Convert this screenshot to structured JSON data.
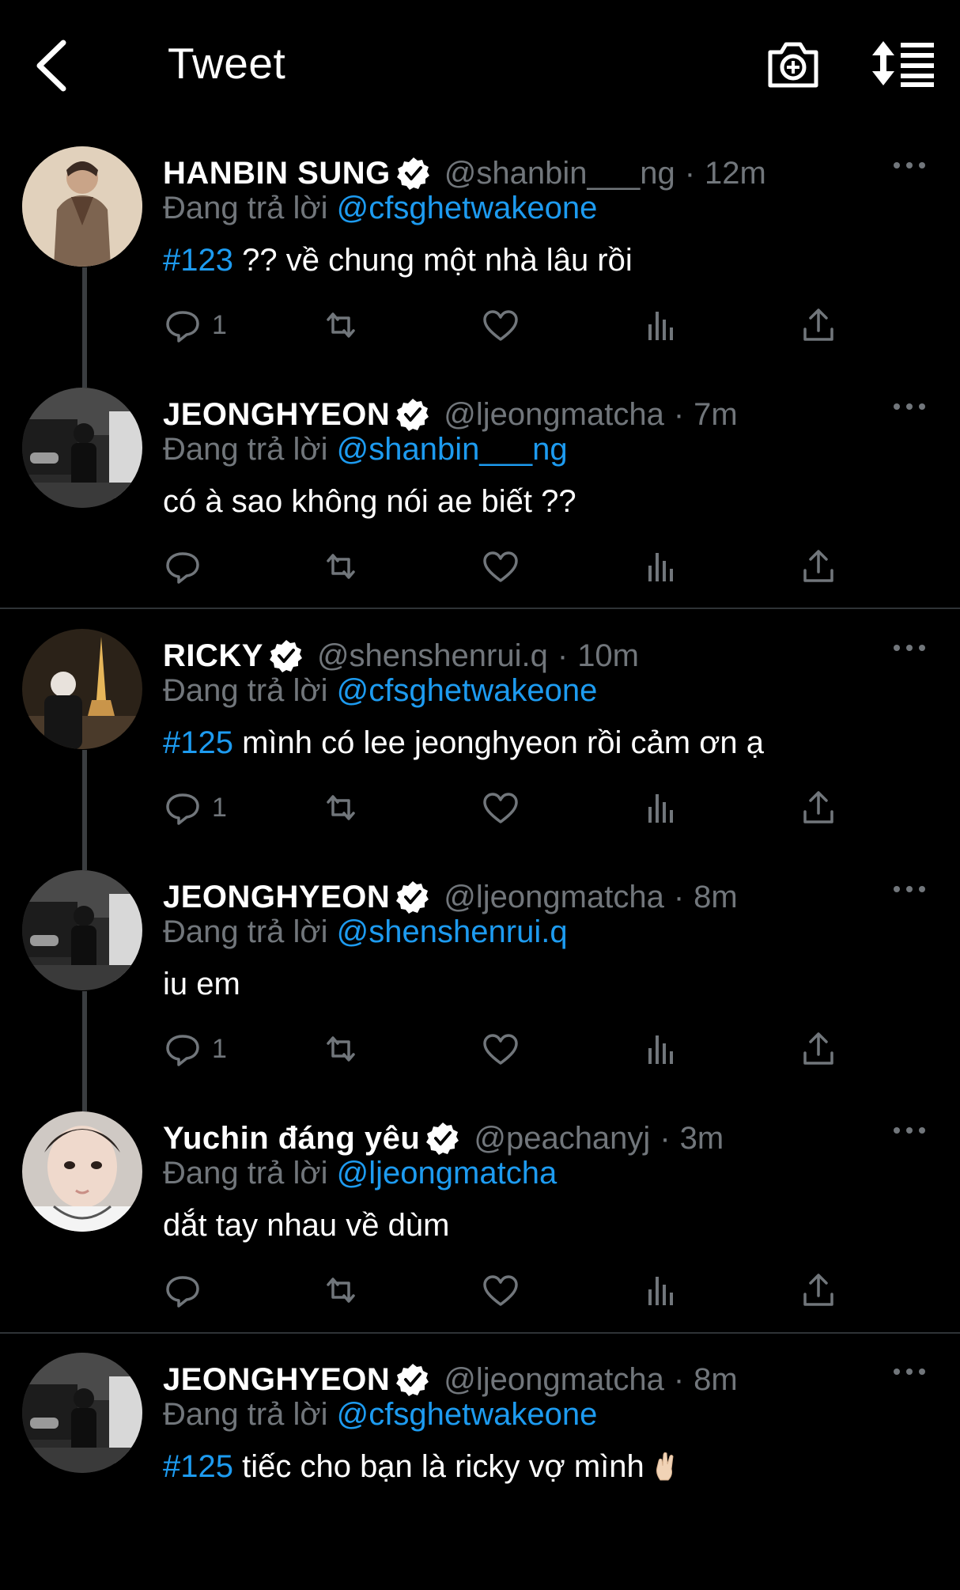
{
  "header": {
    "title": "Tweet"
  },
  "tweets": [
    {
      "name": "HANBIN SUNG",
      "handle": "@shanbin___ng",
      "time": "12m",
      "reply_prefix": "Đang trả lời",
      "reply_to": "@cfsghetwakeone",
      "tag": "#123",
      "text": " ?? về chung một nhà lâu rồi",
      "replies": "1"
    },
    {
      "name": "JEONGHYEON",
      "handle": "@ljeongmatcha",
      "time": "7m",
      "reply_prefix": "Đang trả lời",
      "reply_to": "@shanbin___ng",
      "tag": "",
      "text": "có à sao không nói ae biết ??",
      "replies": ""
    },
    {
      "name": "RICKY",
      "handle": "@shenshenrui.q",
      "time": "10m",
      "reply_prefix": "Đang trả lời",
      "reply_to": "@cfsghetwakeone",
      "tag": "#125",
      "text": " mình có lee jeonghyeon rồi cảm ơn ạ",
      "replies": "1"
    },
    {
      "name": "JEONGHYEON",
      "handle": "@ljeongmatcha",
      "time": "8m",
      "reply_prefix": "Đang trả lời",
      "reply_to": "@shenshenrui.q",
      "tag": "",
      "text": "iu em",
      "replies": "1"
    },
    {
      "name": "Yuchin đáng yêu",
      "handle": "@peachanyj",
      "time": "3m",
      "reply_prefix": "Đang trả lời",
      "reply_to": "@ljeongmatcha",
      "tag": "",
      "text": "dắt tay nhau về dùm",
      "replies": ""
    },
    {
      "name": "JEONGHYEON",
      "handle": "@ljeongmatcha",
      "time": "8m",
      "reply_prefix": "Đang trả lời",
      "reply_to": "@cfsghetwakeone",
      "tag": "#125",
      "text": " tiếc cho bạn là ricky vợ mình",
      "replies": ""
    }
  ],
  "icons": {
    "back": "back-arrow-icon",
    "camera": "camera-plus-icon",
    "sort": "sort-icon",
    "verified": "verified-badge-icon",
    "more": "more-icon",
    "reply": "reply-icon",
    "retweet": "retweet-icon",
    "like": "heart-icon",
    "views": "views-icon",
    "share": "share-icon",
    "emoji": "crossed-fingers-emoji"
  },
  "colors": {
    "background": "#000000",
    "accent": "#1d9bf0",
    "muted": "#71767b",
    "text": "#ffffff"
  }
}
